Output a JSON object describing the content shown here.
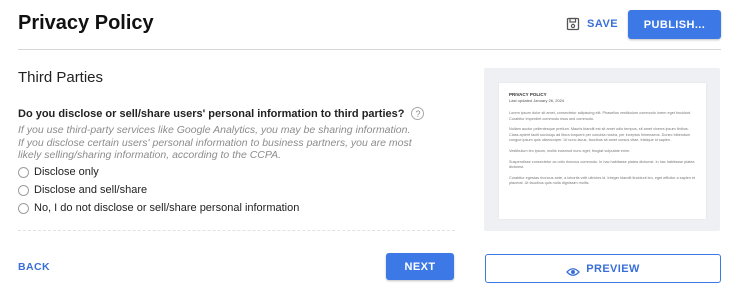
{
  "header": {
    "title": "Privacy Policy",
    "save_label": "SAVE",
    "publish_label": "PUBLISH..."
  },
  "section": {
    "title": "Third Parties"
  },
  "question": {
    "text": "Do you disclose or sell/share users' personal information to third parties?",
    "help_icon": "?",
    "hint": "If you use third-party services like Google Analytics, you may be sharing information. If you disclose certain users' personal information to business partners, you are most likely selling/sharing information, according to the CCPA."
  },
  "options": [
    {
      "label": "Disclose only"
    },
    {
      "label": "Disclose and sell/share"
    },
    {
      "label": "No, I do not disclose or sell/share personal information"
    }
  ],
  "footer": {
    "back_label": "BACK",
    "next_label": "NEXT",
    "preview_label": "PREVIEW"
  },
  "preview_doc": {
    "title": "PRIVACY POLICY",
    "date": "Last updated January 26, 2024",
    "paragraphs": [
      "Lorem ipsum dolor sit amet, consectetur adipiscing elit. Phasellus vestibulum commodo lorem eget tincidunt. Curabitur imperdiet commodo risus sed commodo.",
      "Nullam auctor pellentesque pretium. Mauris blandit est sit amet odio tempus, sit amet viverra ipsum finibus. Class aptent taciti sociosqu ad litora torquent per conubia nostra, per inceptos himenaeos. Donec bibendum congue ipsum quis ullamcorper. Ut nunc lacus, faucibus sit amet cursus vitae, tristique id sapien.",
      "Vestibulum leo ipsum, mollis euismod nunc eget, feugiat vulputate enim.",
      "Suspendisse consectetur ac odio rhoncus commodo. In hac habitasse platea dictumst. In hac habitasse platea dictumst.",
      "Curabitur egestas rhoncus ante, a lobortis velit ultricies id. Integer blandit tincidunt leo, eget efficitur a sapien et placerat. Ut faucibus quis nulla dignissim mollis."
    ]
  },
  "colors": {
    "accent": "#3d79e6",
    "link": "#3a6fd8",
    "hint": "#8c8c8c"
  },
  "icons": {
    "save": "save-icon",
    "help": "help-icon",
    "preview": "eye-icon"
  }
}
